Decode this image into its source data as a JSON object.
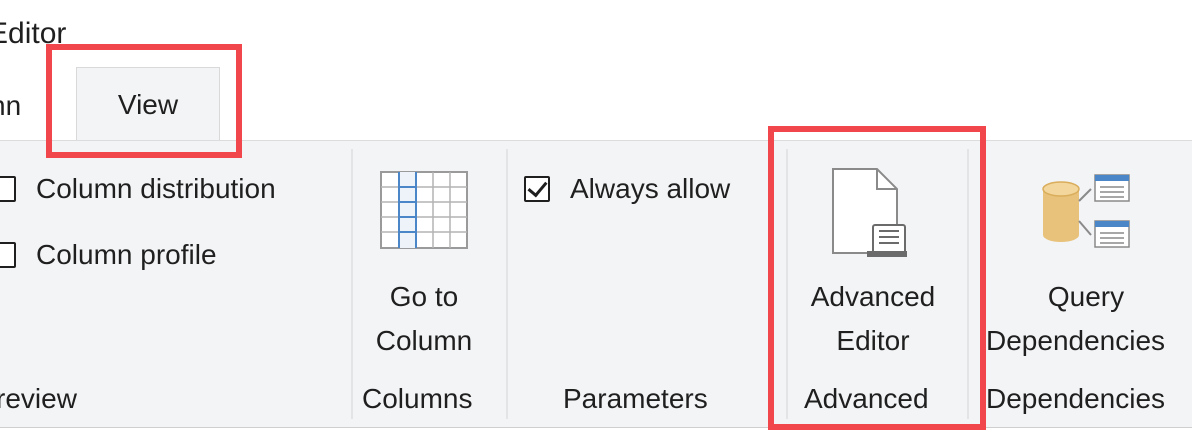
{
  "window": {
    "title": "Editor"
  },
  "tabs": [
    {
      "label": "nn"
    },
    {
      "label": "View",
      "selected": true
    }
  ],
  "ribbon": {
    "preview_group": {
      "label": "review",
      "checkbox_column_distribution": "Column distribution",
      "checkbox_column_profile": "Column profile"
    },
    "columns_group": {
      "label": "Columns",
      "go_to_column_line1": "Go to",
      "go_to_column_line2": "Column"
    },
    "parameters_group": {
      "label": "Parameters",
      "checkbox_always_allow": "Always allow",
      "always_allow_checked": true
    },
    "advanced_group": {
      "label": "Advanced",
      "advanced_editor_line1": "Advanced",
      "advanced_editor_line2": "Editor"
    },
    "dependencies_group": {
      "label": "Dependencies",
      "query_dependencies_line1": "Query",
      "query_dependencies_line2": "Dependencies"
    }
  },
  "icons": {
    "go_to_column": "table-grid-icon",
    "advanced_editor": "document-scroll-icon",
    "query_dependencies": "database-dependencies-icon"
  },
  "colors": {
    "highlight": "#f0464c",
    "ribbon_background": "#f3f4f6",
    "grid_accent": "#4a86c8",
    "database_fill": "#e8c27a"
  }
}
